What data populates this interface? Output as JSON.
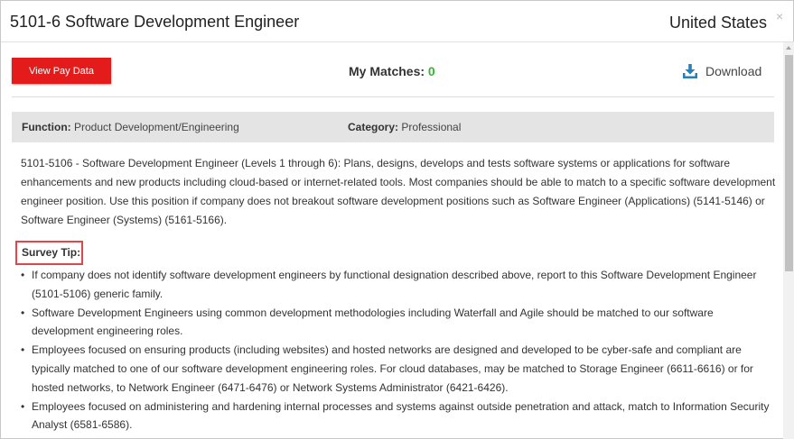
{
  "header": {
    "title": "5101-6 Software Development Engineer",
    "country": "United States",
    "close_glyph": "×"
  },
  "toolbar": {
    "pay_button_label": "View Pay Data",
    "matches_label": "My Matches:",
    "matches_count": "0",
    "download_label": "Download"
  },
  "info": {
    "function_label": "Function:",
    "function_value": "Product Development/Engineering",
    "category_label": "Category:",
    "category_value": "Professional"
  },
  "description": "5101-5106 - Software Development Engineer (Levels 1 through 6): Plans, designs, develops and tests software systems or applications for software enhancements and new products including cloud-based or internet-related tools. Most companies should be able to match to a specific software development engineer position. Use this position if company does not breakout software development positions such as Software Engineer (Applications) (5141-5146) or Software Engineer (Systems) (5161-5166).",
  "survey_tip": {
    "label": "Survey Tip:",
    "items": [
      "If company does not identify software development engineers by functional designation described above, report to this Software Development Engineer (5101-5106) generic family.",
      "Software Development Engineers using common development methodologies including Waterfall and Agile should be matched to our software development engineering roles.",
      "Employees focused on ensuring products (including websites) and hosted networks are designed and developed to be cyber-safe and compliant are typically matched to one of our software development engineering roles. For cloud databases, may be matched to Storage Engineer (6611-6616) or for hosted networks, to Network Engineer (6471-6476) or Network Systems Administrator (6421-6426).",
      "Employees focused on administering and hardening internal processes and systems against outside penetration and attack, match to Information Security Analyst (6581-6586)."
    ]
  },
  "colors": {
    "pay_button": "#e41b1b",
    "matches_count": "#2db82d",
    "download_icon": "#2a7fb8",
    "highlight_box": "#e54545",
    "info_bar": "#e4e4e4"
  }
}
